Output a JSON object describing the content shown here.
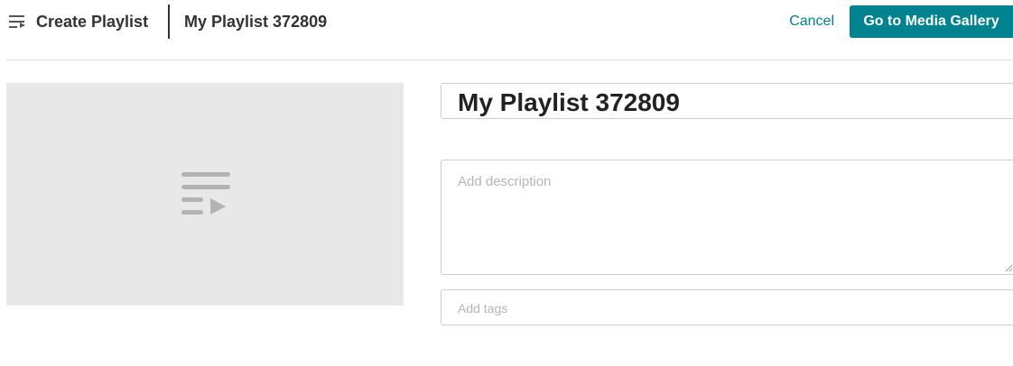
{
  "header": {
    "menu_icon": "playlist-menu-icon",
    "title": "Create Playlist",
    "playlist_name": "My Playlist 372809",
    "cancel_label": "Cancel",
    "primary_label": "Go to Media Gallery"
  },
  "thumbnail": {
    "icon": "playlist-play-icon"
  },
  "form": {
    "title_value": "My Playlist 372809",
    "description_placeholder": "Add description",
    "tags_placeholder": "Add tags"
  },
  "colors": {
    "accent": "#00828f",
    "thumbnail_bg": "#e8e8e8",
    "thumbnail_icon": "#b3b3b3",
    "placeholder": "#b5b5b5"
  }
}
